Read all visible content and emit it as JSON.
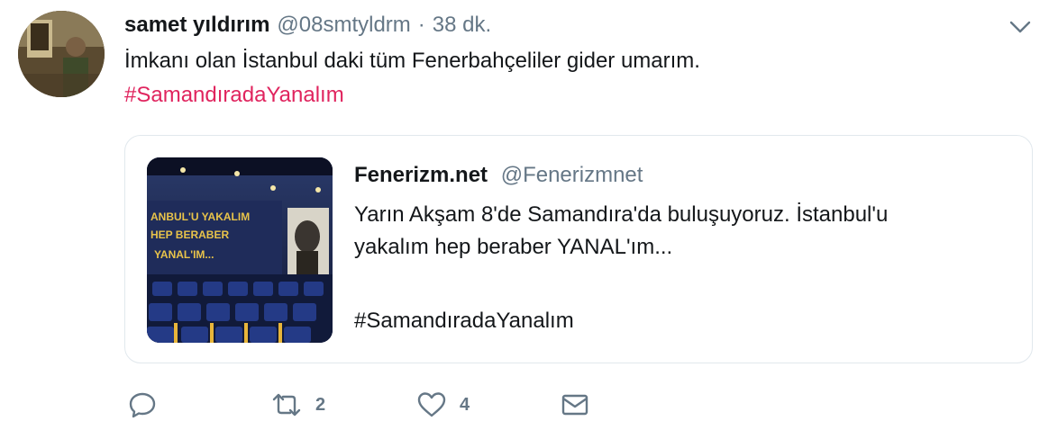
{
  "tweet": {
    "display_name": "samet yıldırım",
    "handle": "@08smtyldrm",
    "separator": "·",
    "timestamp": "38 dk.",
    "text": "İmkanı olan İstanbul daki tüm Fenerbahçeliler gider umarım.",
    "hashtag": "#SamandıradaYanalım"
  },
  "quote": {
    "display_name": "Fenerizm.net",
    "handle": "@Fenerizmnet",
    "text_lines": [
      "Yarın Akşam 8'de Samandıra'da buluşuyoruz. İstanbul'u",
      "yakalım hep beraber YANAL'ım..."
    ],
    "hashtag": "#SamandıradaYanalım",
    "image_banner_lines": [
      "ANBUL'U YAKALIM",
      "HEP BERABER",
      "YANAL'IM..."
    ]
  },
  "actions": {
    "reply_count": "",
    "retweet_count": "2",
    "like_count": "4"
  },
  "icons": {
    "caret": "chevron-down-icon",
    "reply": "reply-icon",
    "retweet": "retweet-icon",
    "like": "heart-icon",
    "dm": "envelope-icon"
  },
  "colors": {
    "hashtag": "#e0245e",
    "secondary_text": "#657786",
    "border": "#e1e8ed",
    "icon": "#657786"
  }
}
